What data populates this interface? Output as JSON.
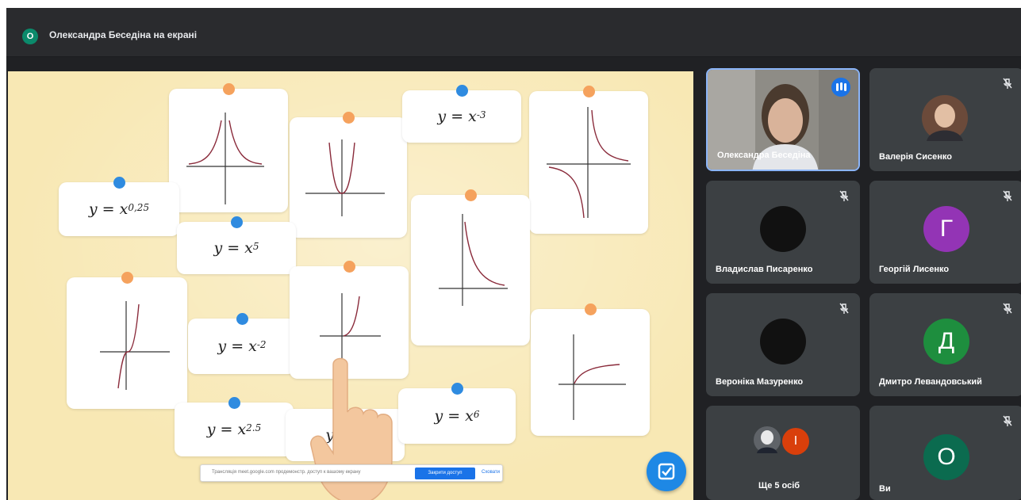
{
  "topbar": {
    "presenter_initial": "О",
    "presenting_label": "Олександра Беседіна на екрані"
  },
  "screen": {
    "formulas": {
      "x025": {
        "base": "y = x",
        "exp": "0,25"
      },
      "x5": {
        "base": "y = x",
        "exp": "5"
      },
      "xm2": {
        "base": "y = x",
        "exp": "-2"
      },
      "x25": {
        "base": "y = x",
        "exp": "2.5"
      },
      "x": {
        "base": "y = x",
        "exp": ""
      },
      "xm3": {
        "base": "y = x",
        "exp": "-3"
      },
      "x6": {
        "base": "y = x",
        "exp": "6"
      }
    },
    "permission_bar": {
      "message": "Трансляція meet.google.com продемонстр. доступ к вашому екрану",
      "stop_label": "Закрити доступ",
      "hide_label": "Сховати"
    }
  },
  "participants": [
    {
      "name": "Олександра Беседіна",
      "avatar": "video",
      "speaking": true
    },
    {
      "name": "Валерія Сисенко",
      "avatar": "photo",
      "muted": true
    },
    {
      "name": "Владислав Писаренко",
      "avatar": "dark",
      "muted": true
    },
    {
      "name": "Георгій Лисенко",
      "avatar": "Г",
      "avatar_color": "#9334b5",
      "muted": true
    },
    {
      "name": "Вероніка Мазуренко",
      "avatar": "dark",
      "muted": true
    },
    {
      "name": "Дмитро Левандовський",
      "avatar": "Д",
      "avatar_color": "#1e8e3e",
      "muted": true
    },
    {
      "name": "Ще 5 осіб",
      "avatar": "group",
      "group_initial": "І"
    },
    {
      "name": "Ви",
      "avatar": "О",
      "avatar_color": "#0b6b4f",
      "muted": true
    }
  ],
  "colors": {
    "pin_orange": "#f5a25d",
    "pin_blue": "#2f8be0",
    "board": "#f8e8b4",
    "tile": "#3c4043",
    "accent": "#1a73e8"
  },
  "icons": [
    "mic-off-icon",
    "speaking-indicator-icon",
    "checkmark-icon",
    "hand-pointer-icon"
  ]
}
